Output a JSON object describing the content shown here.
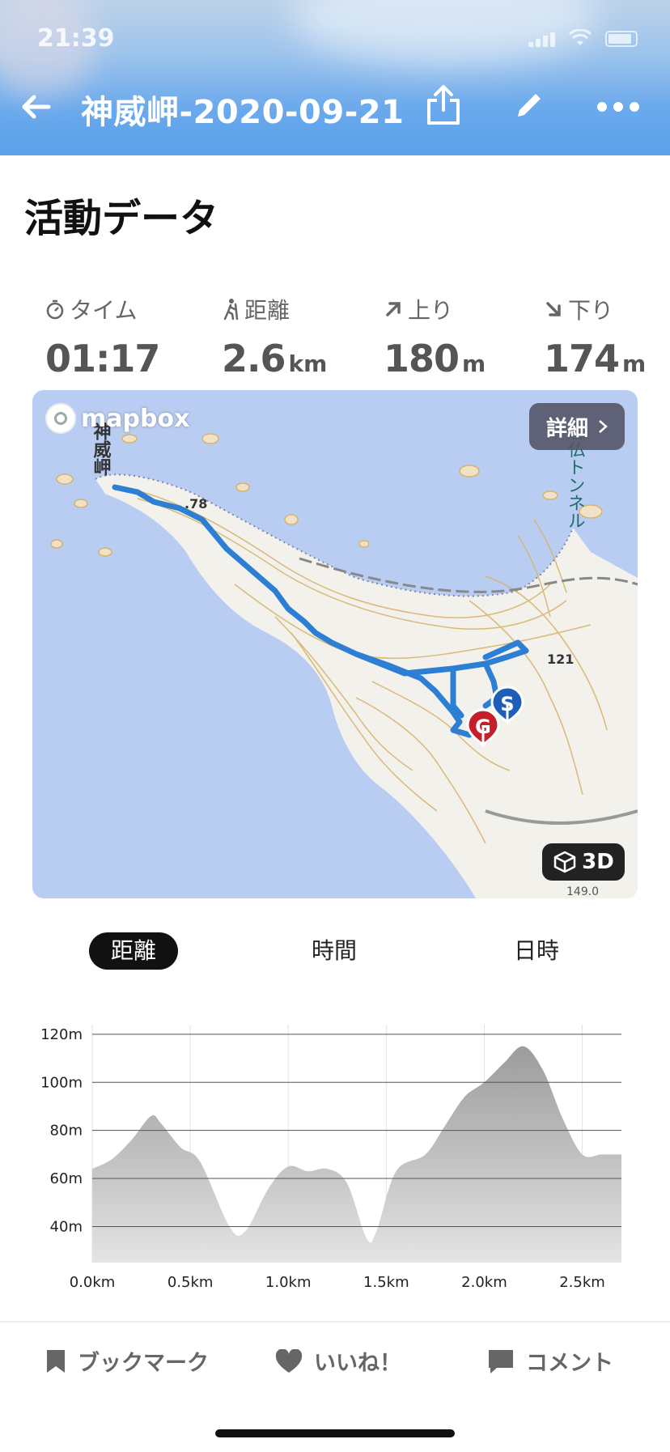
{
  "status_bar": {
    "time": "21:39"
  },
  "header": {
    "title": "神威岬-2020-09-21"
  },
  "section_title": "活動データ",
  "stats": [
    {
      "icon": "timer-icon",
      "label": "タイム",
      "value": "01:17",
      "unit": ""
    },
    {
      "icon": "hiker-icon",
      "label": "距離",
      "value": "2.6",
      "unit": "km"
    },
    {
      "icon": "arrow-up-right-icon",
      "label": "上り",
      "value": "180",
      "unit": "m"
    },
    {
      "icon": "arrow-down-right-icon",
      "label": "下り",
      "value": "174",
      "unit": "m"
    }
  ],
  "map": {
    "logo_text": "mapbox",
    "detail_label": "詳細",
    "btn_3d_label": "3D",
    "place_label": "神威岬",
    "tunnel_label": "念仏トンネル",
    "peak_labels": [
      ".78",
      "121",
      "149.0"
    ],
    "start_marker": "S",
    "goal_marker": "G",
    "colors": {
      "sea": "#b9cdf3",
      "land": "#f3f1ec",
      "route": "#2d7fd3",
      "contour": "#d8b36a",
      "start": "#1d5fb8",
      "goal": "#c4202c"
    }
  },
  "tabs": [
    {
      "label": "距離",
      "active": true
    },
    {
      "label": "時間",
      "active": false
    },
    {
      "label": "日時",
      "active": false
    }
  ],
  "chart_data": {
    "type": "area",
    "x": [
      0.0,
      0.1,
      0.2,
      0.3,
      0.35,
      0.45,
      0.55,
      0.7,
      0.78,
      0.9,
      1.0,
      1.1,
      1.2,
      1.3,
      1.4,
      1.45,
      1.55,
      1.7,
      1.8,
      1.9,
      2.0,
      2.1,
      2.2,
      2.3,
      2.4,
      2.5,
      2.6,
      2.7
    ],
    "y": [
      64,
      68,
      76,
      86,
      83,
      73,
      67,
      40,
      38,
      56,
      65,
      63,
      64,
      58,
      35,
      38,
      63,
      70,
      82,
      94,
      100,
      108,
      115,
      105,
      85,
      70,
      70,
      70
    ],
    "xticks": [
      "0.0km",
      "0.5km",
      "1.0km",
      "1.5km",
      "2.0km",
      "2.5km"
    ],
    "yticks": [
      "40m",
      "60m",
      "80m",
      "100m",
      "120m"
    ],
    "xlim": [
      0,
      2.7
    ],
    "ylim": [
      25,
      124
    ],
    "grid": true
  },
  "bottom_bar": {
    "bookmark_label": "ブックマーク",
    "like_label": "いいね！",
    "comment_label": "コメント"
  }
}
